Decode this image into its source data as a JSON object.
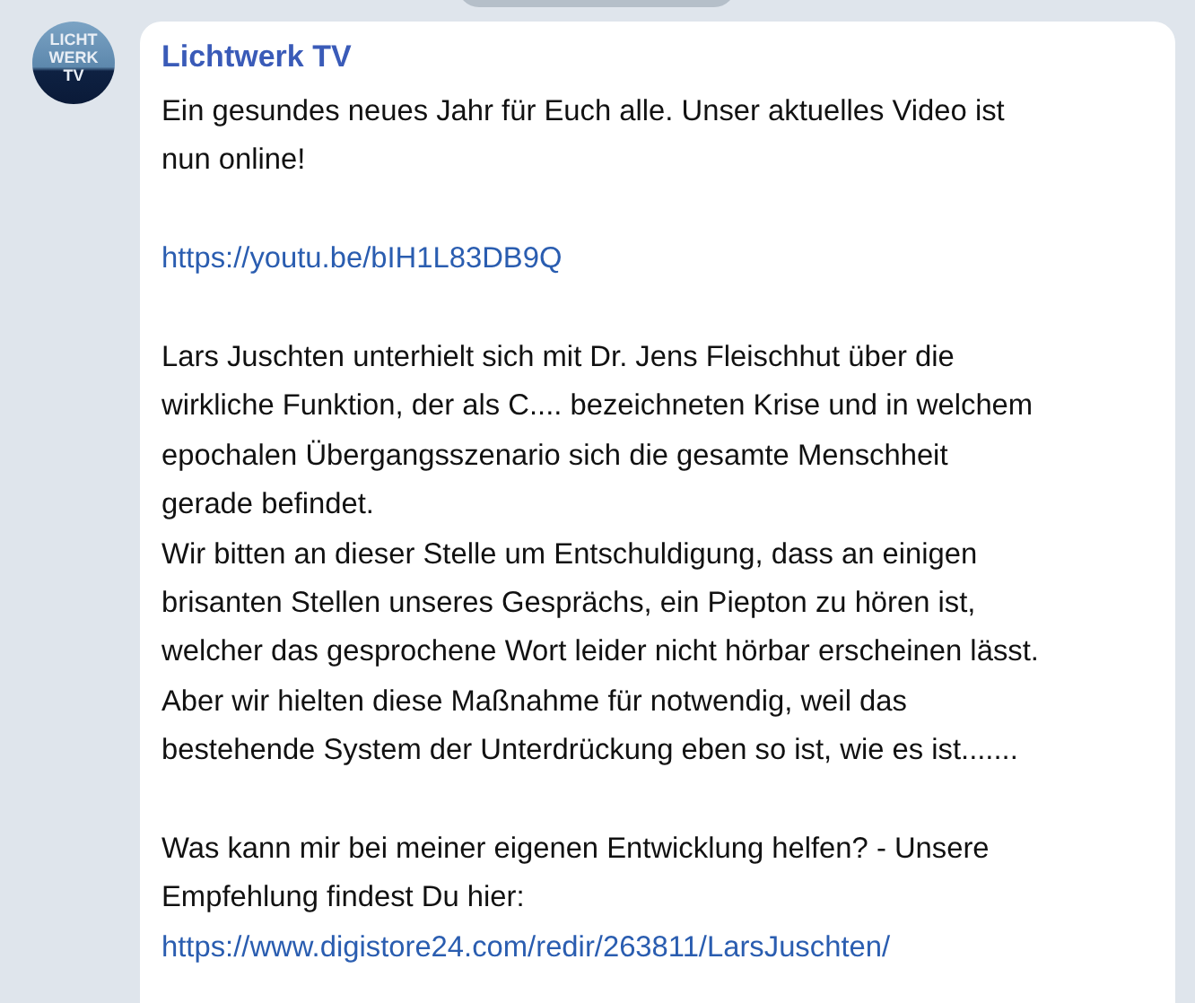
{
  "avatar": {
    "lines": [
      "LICHT",
      "WERK",
      "TV"
    ]
  },
  "channel": {
    "name": "Lichtwerk TV"
  },
  "blocks": [
    {
      "kind": "text",
      "lines": [
        "Ein gesundes neues Jahr für Euch alle. Unser aktuelles Video ist",
        "nun online!"
      ]
    },
    {
      "kind": "link",
      "text": "https://youtu.be/bIH1L83DB9Q"
    },
    {
      "kind": "text",
      "lines": [
        "Lars Juschten unterhielt sich mit Dr. Jens Fleischhut über die",
        "wirkliche Funktion, der als C.... bezeichneten Krise und in welchem",
        "epochalen Übergangsszenario sich die gesamte Menschheit",
        "gerade befindet.",
        "Wir bitten an dieser Stelle um Entschuldigung, dass an einigen",
        "brisanten Stellen unseres Gesprächs, ein Piepton zu hören ist,",
        "welcher das gesprochene Wort leider nicht hörbar erscheinen lässt.",
        "Aber wir hielten diese Maßnahme für notwendig, weil das",
        "bestehende System der Unterdrückung eben so ist, wie es ist......."
      ]
    },
    {
      "kind": "text",
      "lines": [
        "Was kann mir bei meiner eigenen Entwicklung helfen? - Unsere",
        "Empfehlung findest Du hier:"
      ],
      "link": "https://www.digistore24.com/redir/263811/LarsJuschten/"
    }
  ]
}
